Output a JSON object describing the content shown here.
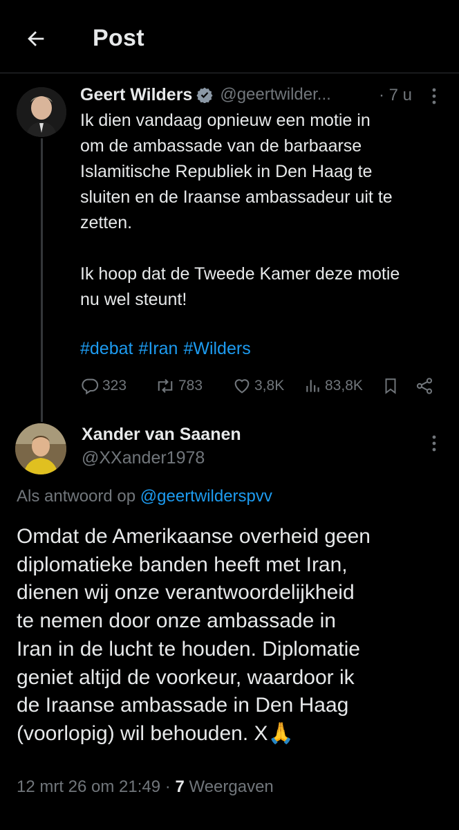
{
  "header": {
    "title": "Post"
  },
  "post": {
    "author_name": "Geert Wilders",
    "handle": "@geertwilder...",
    "time": "· 7 u",
    "paragraph1_lines": [
      "Ik dien vandaag opnieuw een motie in",
      "om de ambassade van de barbaarse",
      "Islamitische Republiek in Den Haag te",
      "sluiten en de Iraanse ambassadeur uit te",
      "zetten."
    ],
    "paragraph2_lines": [
      "Ik hoop dat de Tweede Kamer deze motie",
      "nu wel steunt!"
    ],
    "hashtags": [
      "#debat",
      "#Iran",
      "#Wilders"
    ],
    "stats": {
      "replies": "323",
      "reposts": "783",
      "likes": "3,8K",
      "views": "83,8K"
    }
  },
  "reply": {
    "author_name": "Xander van Saanen",
    "handle": "@XXander1978",
    "reply_prefix": "Als antwoord op",
    "reply_mention": "@geertwilderspvv",
    "text_lines": [
      "Omdat de Amerikaanse overheid geen",
      "diplomatieke banden heeft met Iran,",
      "dienen wij onze verantwoordelijkheid",
      "te nemen door onze ambassade in",
      "Iran in de lucht te houden. Diplomatie",
      "geniet altijd de voorkeur, waardoor ik",
      "de Iraanse ambassade in Den Haag",
      "(voorlopig) wil behouden. X🙏"
    ],
    "timestamp": "12 mrt 26 om 21:49 ·",
    "views_count": "7",
    "views_label": "Weergaven"
  },
  "icons": {
    "back": "arrow-left-icon",
    "verified": "verified-badge-icon",
    "more": "more-vertical-icon",
    "reply": "comment-icon",
    "repost": "repost-icon",
    "like": "heart-icon",
    "views": "bar-chart-icon",
    "bookmark": "bookmark-icon",
    "share": "share-icon"
  },
  "colors": {
    "background": "#000000",
    "text": "#e7e9ea",
    "muted": "#71767b",
    "accent": "#1d9bf0",
    "divider": "#2f3336"
  }
}
